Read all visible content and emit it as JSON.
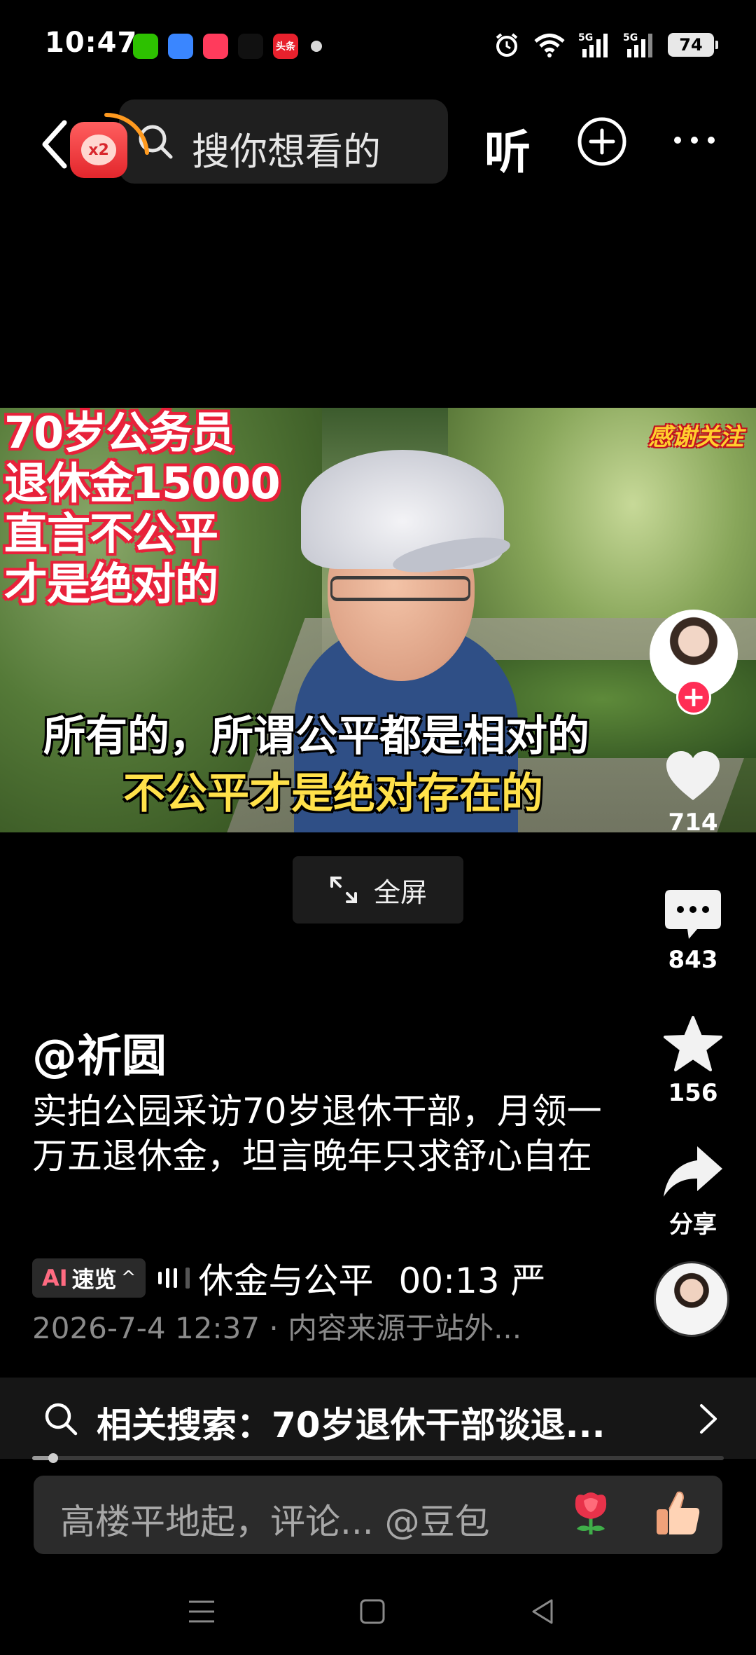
{
  "status_bar": {
    "time": "10:47",
    "notifications": [
      {
        "name": "wechat-icon",
        "color": "#2dc100",
        "glyph": ""
      },
      {
        "name": "browser-icon",
        "color": "#3a86ff",
        "glyph": ""
      },
      {
        "name": "game-icon",
        "color": "#ff3b5c",
        "glyph": ""
      },
      {
        "name": "tiktok-icon",
        "color": "#111111",
        "glyph": ""
      },
      {
        "name": "toutiao-icon",
        "color": "#e8212d",
        "glyph": "头条"
      }
    ],
    "battery": "74"
  },
  "top_nav": {
    "search_placeholder": "搜你想看的",
    "redpacket_badge": "x2",
    "listen_label": "听"
  },
  "video": {
    "overlay_lines": [
      "70岁公务员",
      "退休金15000",
      "直言不公平",
      "才是绝对的"
    ],
    "badge": "感谢关注",
    "subtitle_line1": "所有的，所谓公平都是相对的",
    "subtitle_line2": "不公平才是绝对存在的"
  },
  "fullscreen": {
    "label": "全屏"
  },
  "rail": {
    "like_count": "714",
    "comment_count": "843",
    "favorite_count": "156",
    "share_label": "分享"
  },
  "caption": {
    "author": "@祈圆",
    "description": "实拍公园采访70岁退休干部，月领一万五退休金，坦言晚年只求舒心自在",
    "ai_label": "速览",
    "ai_prefix": "AI",
    "ai_topic": "休金与公平",
    "ai_time": "00:13 严",
    "meta": "2026-7-4 12:37 · 内容来源于站外..."
  },
  "related_search": {
    "text": "相关搜索：70岁退休干部谈退..."
  },
  "playback": {
    "progress_fraction": 0.03
  },
  "comment_bar": {
    "placeholder": "高楼平地起，评论... @豆包"
  }
}
